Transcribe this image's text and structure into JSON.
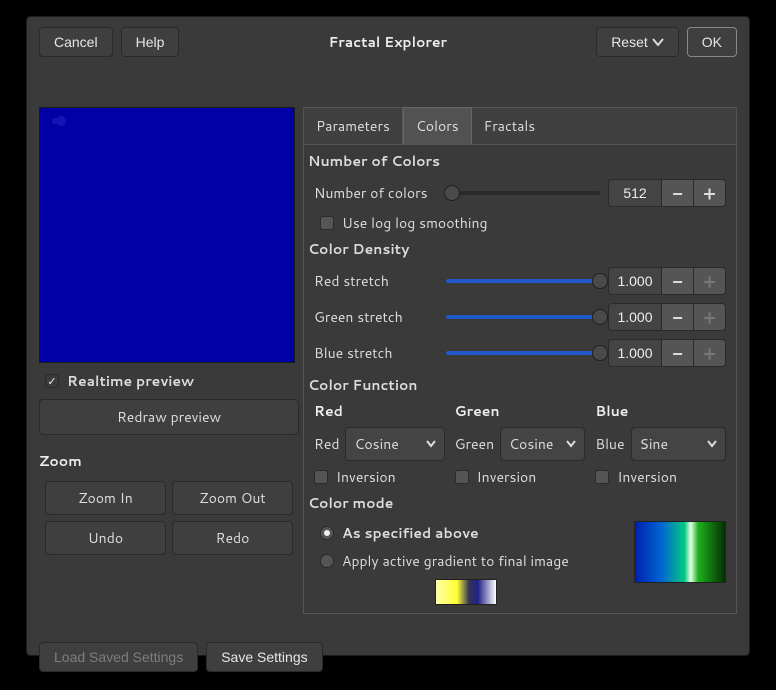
{
  "header": {
    "cancel": "Cancel",
    "help": "Help",
    "title": "Fractal Explorer",
    "reset": "Reset",
    "ok": "OK"
  },
  "preview": {
    "realtime_label": "Realtime preview",
    "realtime_checked": true,
    "redraw": "Redraw preview"
  },
  "zoom": {
    "title": "Zoom",
    "in": "Zoom In",
    "out": "Zoom Out",
    "undo": "Undo",
    "redo": "Redo"
  },
  "tabs": [
    "Parameters",
    "Colors",
    "Fractals"
  ],
  "active_tab": 1,
  "numcolors": {
    "title": "Number of Colors",
    "label": "Number of colors",
    "value": "512",
    "slider_pct": 4,
    "loglog_label": "Use log log smoothing",
    "loglog_checked": false
  },
  "density": {
    "title": "Color Density",
    "rows": [
      {
        "label": "Red stretch",
        "value": "1.000",
        "slider_pct": 100
      },
      {
        "label": "Green stretch",
        "value": "1.000",
        "slider_pct": 100
      },
      {
        "label": "Blue stretch",
        "value": "1.000",
        "slider_pct": 100
      }
    ]
  },
  "function": {
    "title": "Color Function",
    "cols": [
      {
        "head": "Red",
        "label": "Red",
        "value": "Cosine",
        "inversion_label": "Inversion",
        "inversion_checked": false
      },
      {
        "head": "Green",
        "label": "Green",
        "value": "Cosine",
        "inversion_label": "Inversion",
        "inversion_checked": false
      },
      {
        "head": "Blue",
        "label": "Blue",
        "value": "Sine",
        "inversion_label": "Inversion",
        "inversion_checked": false
      }
    ]
  },
  "colormode": {
    "title": "Color mode",
    "opt_above": "As specified above",
    "opt_gradient": "Apply active gradient to final image",
    "selected": 0
  },
  "bottom": {
    "load": "Load Saved Settings",
    "save": "Save Settings"
  }
}
